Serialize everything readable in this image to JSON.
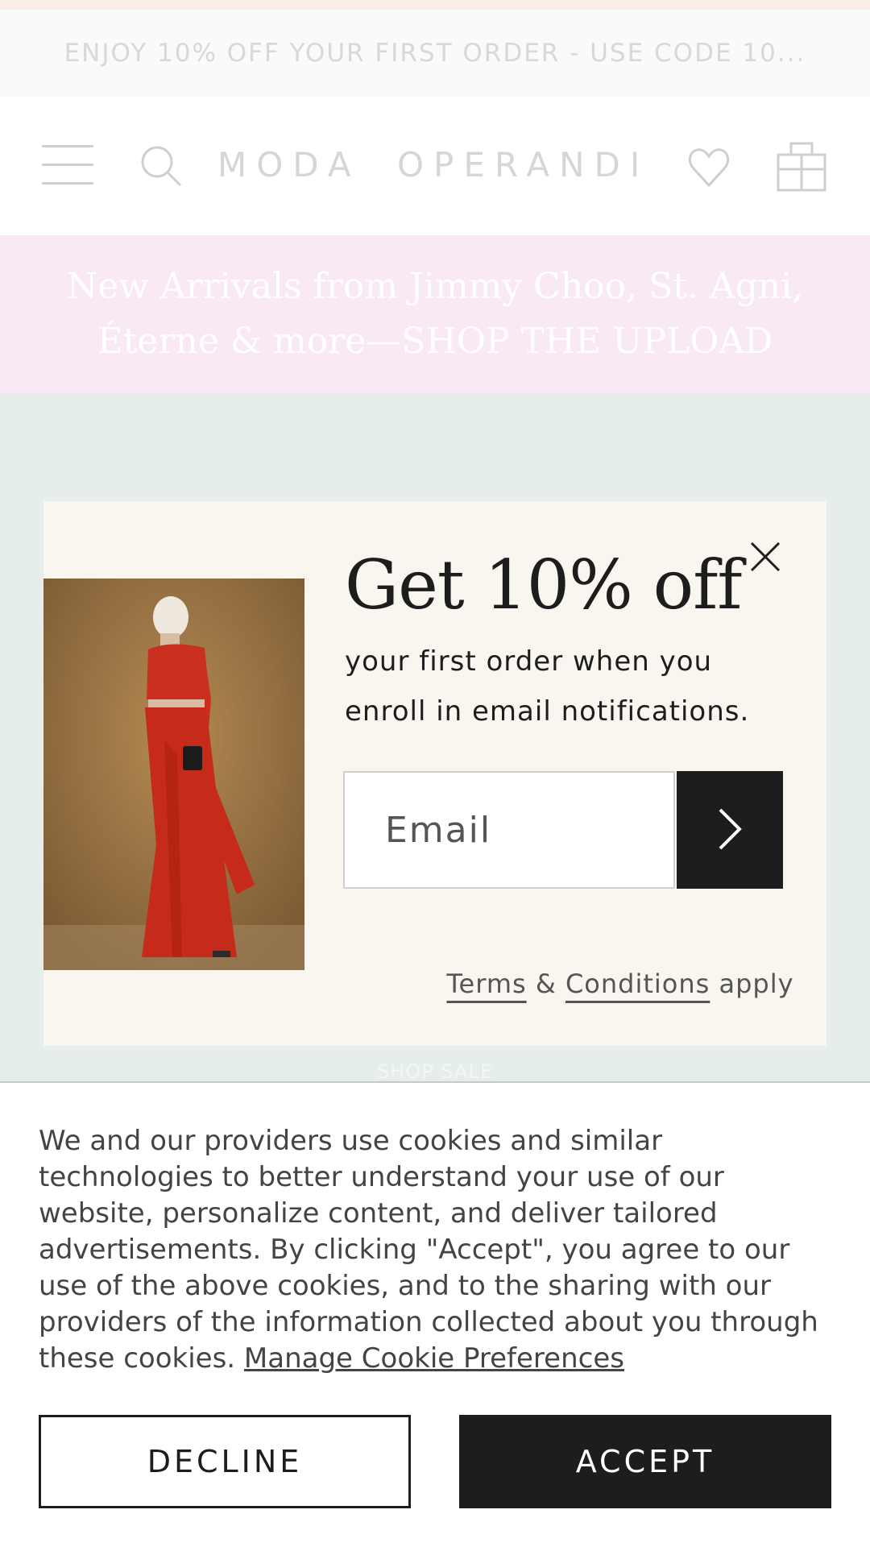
{
  "promo_bar": {
    "text": "ENJOY 10% OFF YOUR FIRST ORDER - USE CODE 10..."
  },
  "header": {
    "logo": "MODA OPERANDI",
    "menu_icon": "hamburger-menu-icon",
    "search_icon": "search-icon",
    "wishlist_icon": "heart-icon",
    "bag_icon": "shopping-bag-icon"
  },
  "banner": {
    "line1": "New Arrivals from Jimmy Choo, St. Agni,",
    "line2": "Éterne & more—SHOP THE UPLOAD"
  },
  "hero": {
    "cta": "SHOP SALE"
  },
  "modal": {
    "headline": "Get 10% off",
    "subtext": "your first order when you enroll in email notifications.",
    "email_placeholder": "Email",
    "submit_icon": "chevron-right-icon",
    "close_icon": "close-icon",
    "terms_link": "Terms",
    "terms_amp": "&",
    "conditions_link": "Conditions",
    "terms_suffix": "apply"
  },
  "cookie_banner": {
    "text": "We and our providers use cookies and similar technologies to better understand your use of our website, personalize content, and deliver tailored advertisements. By clicking \"Accept\", you agree to our use of the above cookies, and to the sharing with our providers of the information collected about you through these cookies.",
    "manage_link": "Manage Cookie Preferences",
    "decline_label": "DECLINE",
    "accept_label": "ACCEPT"
  },
  "colors": {
    "accent_dark": "#1d1d1d",
    "banner_pink": "#f8e9f4",
    "hero_mint": "#e6eeeb",
    "modal_cream": "#f9f6ef"
  }
}
